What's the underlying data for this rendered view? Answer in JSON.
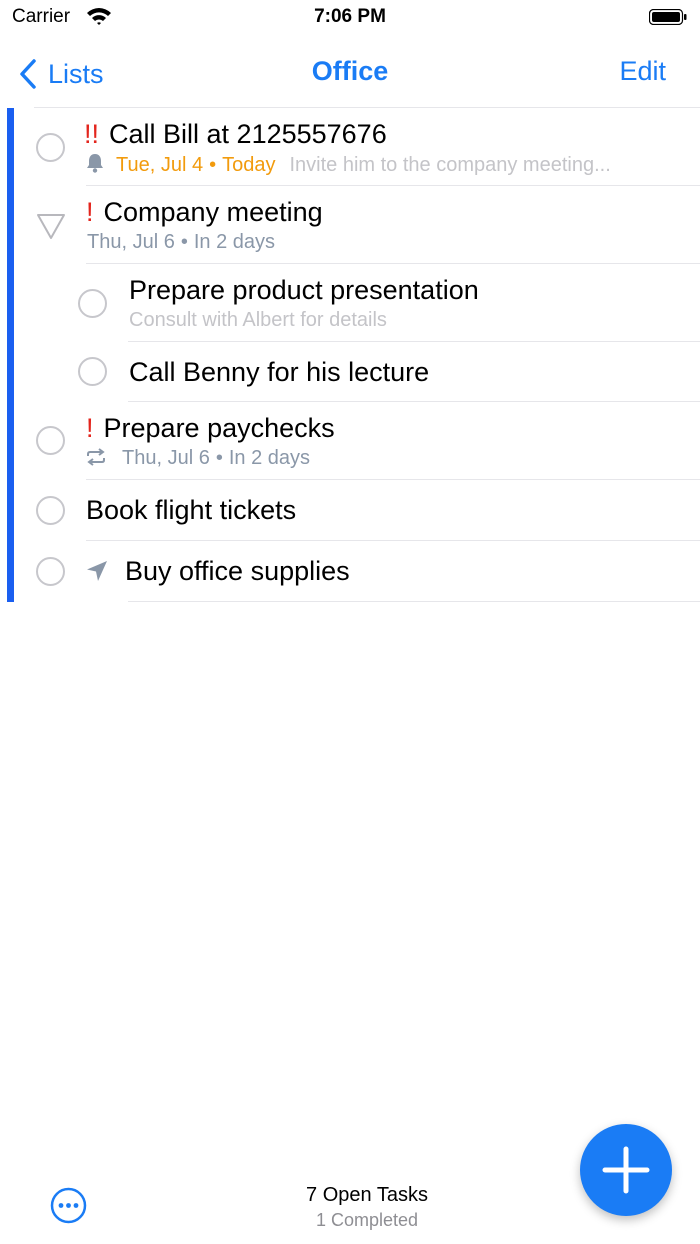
{
  "status_bar": {
    "carrier": "Carrier",
    "time": "7:06 PM"
  },
  "nav": {
    "back_label": "Lists",
    "title": "Office",
    "edit_label": "Edit"
  },
  "tasks": [
    {
      "priority": "!!",
      "title": "Call Bill at 2125557676",
      "date": "Tue, Jul 4",
      "relative": "Today",
      "note": "Invite him to the company meeting..."
    },
    {
      "priority": "!",
      "title": "Company meeting",
      "date": "Thu, Jul 6",
      "relative": "In 2 days"
    },
    {
      "title": "Prepare product presentation",
      "note": "Consult with Albert for details"
    },
    {
      "title": "Call Benny for his lecture"
    },
    {
      "priority": "!",
      "title": "Prepare paychecks",
      "date": "Thu, Jul 6",
      "relative": "In 2 days"
    },
    {
      "title": "Book flight tickets"
    },
    {
      "title": "Buy office supplies"
    }
  ],
  "footer": {
    "open_tasks": "7 Open Tasks",
    "completed": "1 Completed"
  },
  "dot_separator": "•",
  "colors": {
    "accent": "#1a7cf5",
    "list_bar": "#1a5ff0",
    "priority": "#e3251d",
    "due_today": "#f29b0d",
    "meta": "#8a97a8"
  },
  "icons": [
    "wifi-icon",
    "battery-icon",
    "chevron-left-icon",
    "bell-icon",
    "disclosure-triangle-icon",
    "repeat-icon",
    "location-arrow-icon",
    "more-icon",
    "plus-icon"
  ]
}
